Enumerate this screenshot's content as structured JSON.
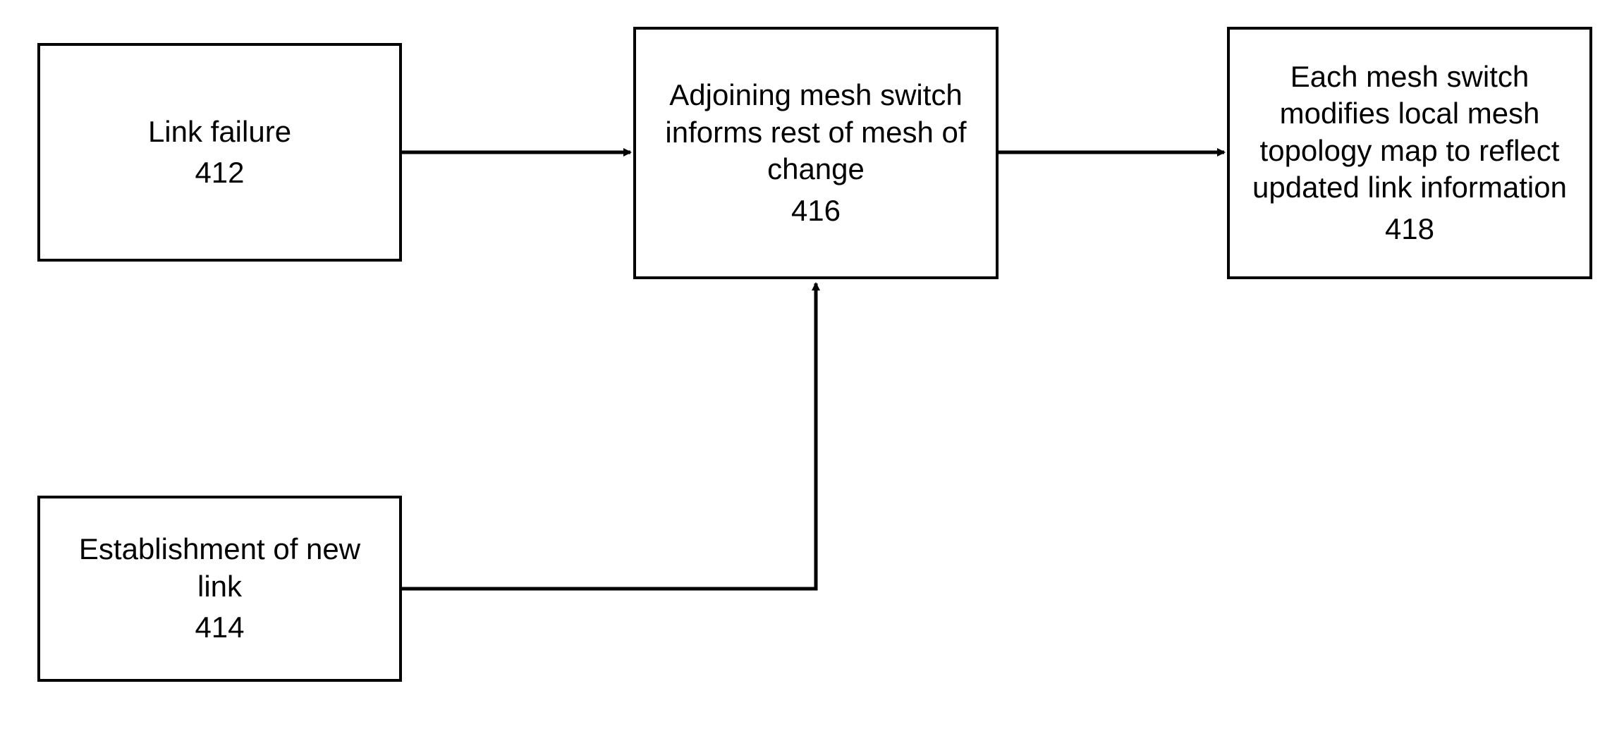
{
  "boxes": {
    "link_failure": {
      "label": "Link failure",
      "num": "412"
    },
    "new_link": {
      "label": "Establishment of new link",
      "num": "414"
    },
    "informs": {
      "label": "Adjoining mesh switch informs rest of mesh of change",
      "num": "416"
    },
    "modifies": {
      "label": "Each mesh switch modifies local mesh topology map to reflect updated link information",
      "num": "418"
    }
  }
}
